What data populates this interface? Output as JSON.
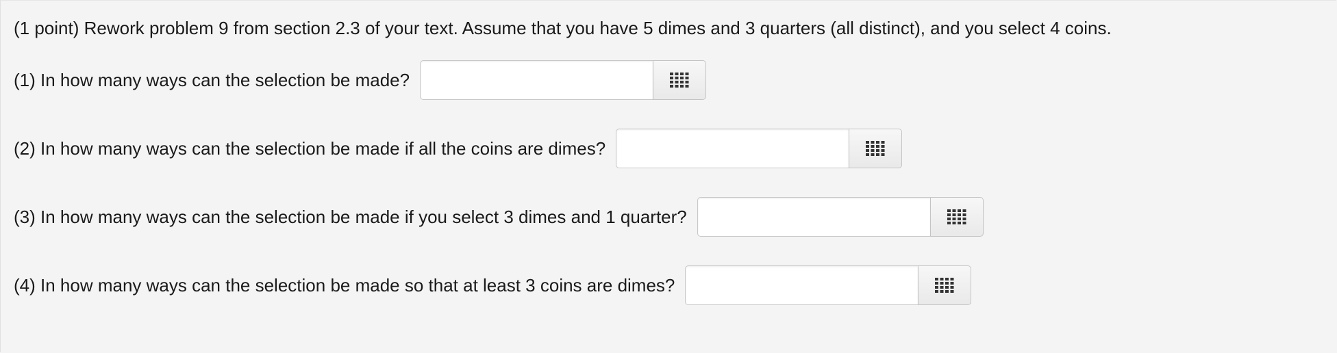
{
  "problem": {
    "intro": "(1 point) Rework problem 9 from section 2.3 of your text. Assume that you have 5 dimes and 3 quarters (all distinct), and you select 4 coins.",
    "questions": [
      {
        "label": "(1) In how many ways can the selection be made?",
        "value": "",
        "placeholder": "",
        "button_icon": "grid-icon"
      },
      {
        "label": "(2) In how many ways can the selection be made if all the coins are dimes?",
        "value": "",
        "placeholder": "",
        "button_icon": "grid-icon"
      },
      {
        "label": "(3) In how many ways can the selection be made if you select 3 dimes and 1 quarter?",
        "value": "",
        "placeholder": "",
        "button_icon": "grid-icon"
      },
      {
        "label": "(4) In how many ways can the selection be made so that at least 3 coins are dimes?",
        "value": "",
        "placeholder": "",
        "button_icon": "grid-icon"
      }
    ]
  },
  "colors": {
    "page_background": "#f4f4f4",
    "text": "#1a1a1a",
    "input_border": "#c8c8c8",
    "icon": "#333333"
  }
}
